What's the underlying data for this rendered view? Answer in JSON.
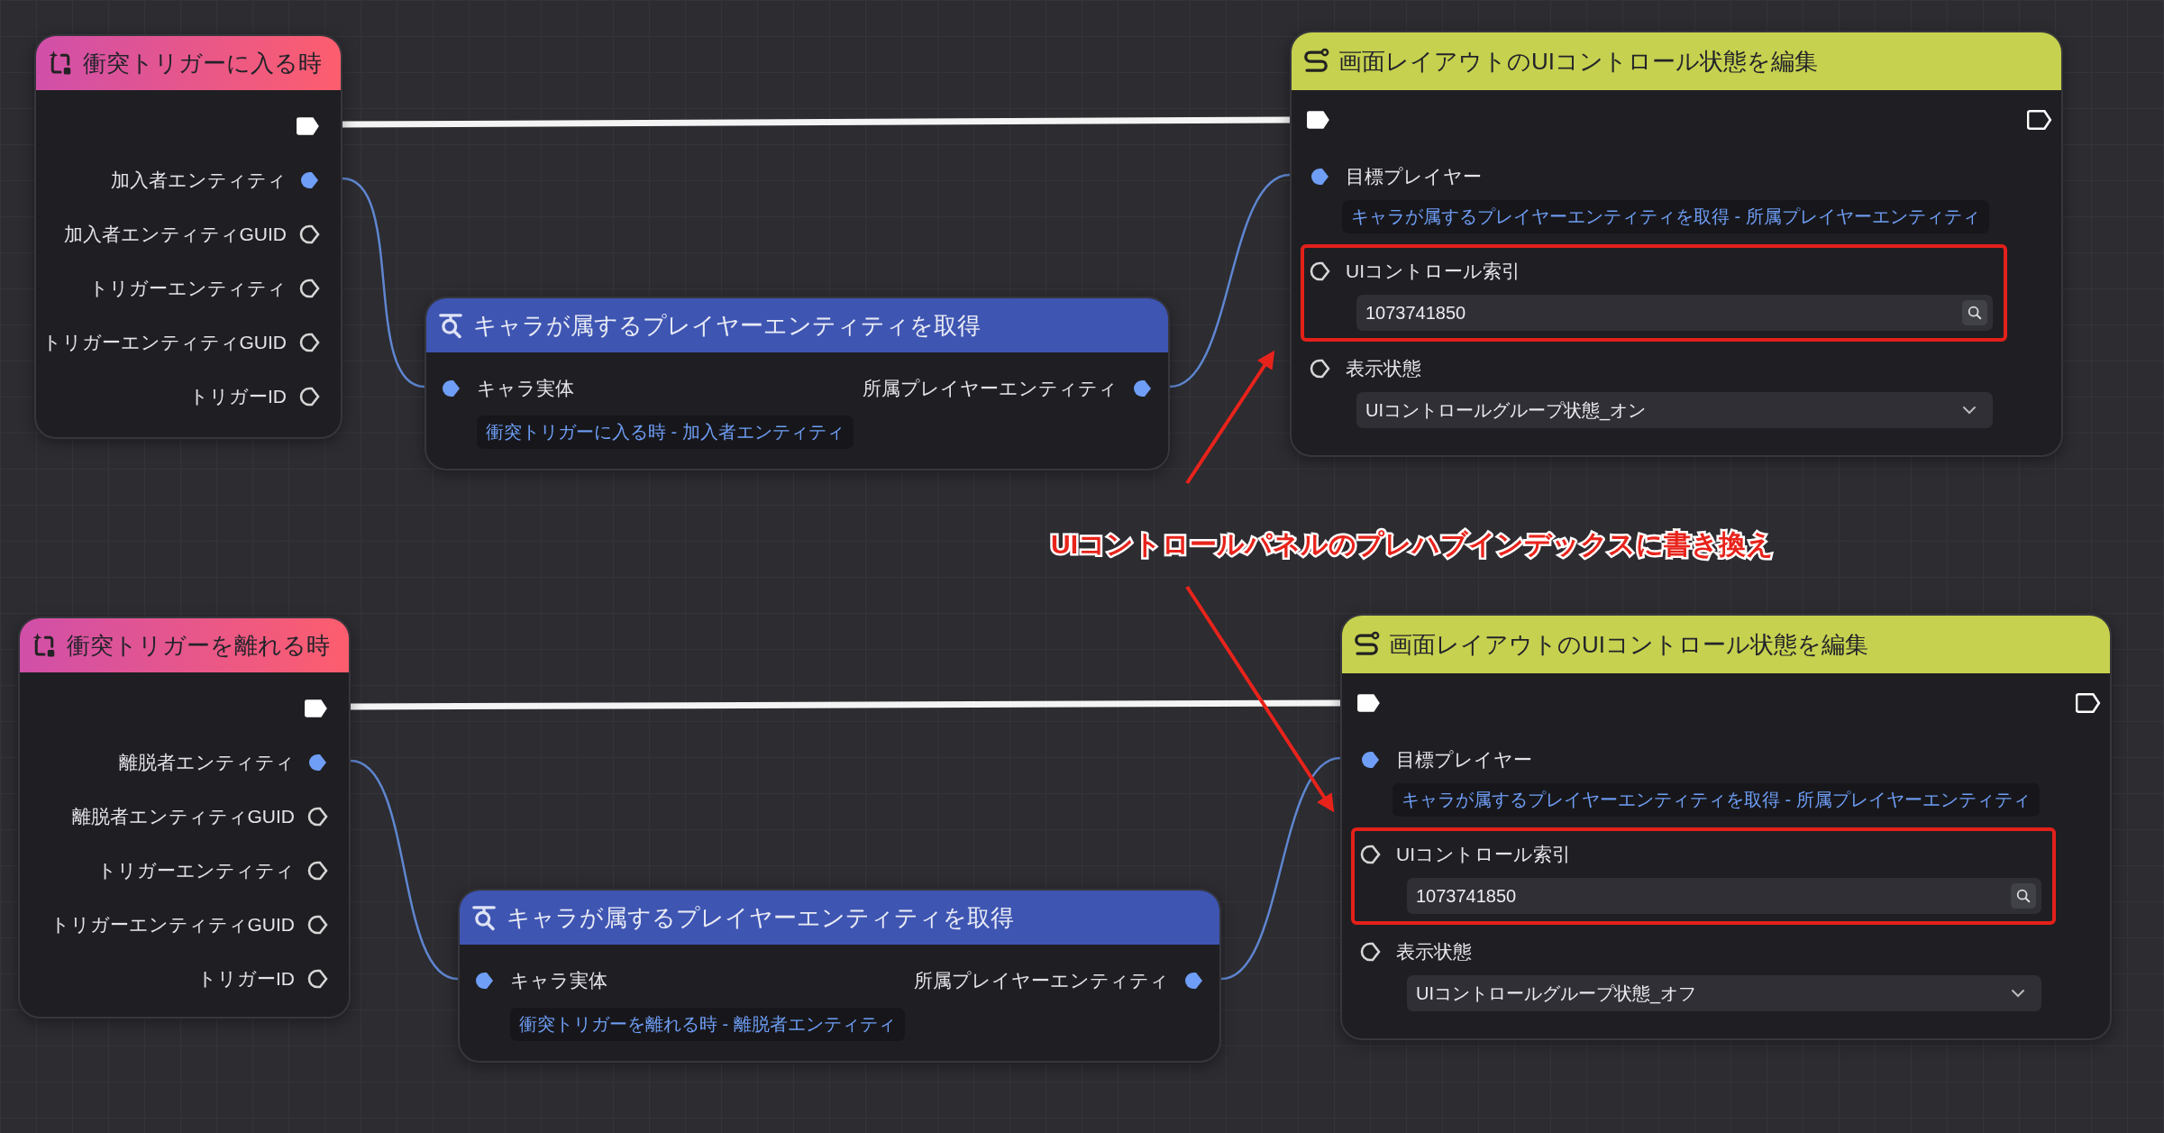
{
  "graphs": [
    {
      "event_node": {
        "title": "衝突トリガーに入る時",
        "exec_out": {
          "connected": true
        },
        "outputs": [
          {
            "label": "加入者エンティティ",
            "connected": true
          },
          {
            "label": "加入者エンティティGUID",
            "connected": false
          },
          {
            "label": "トリガーエンティティ",
            "connected": false
          },
          {
            "label": "トリガーエンティティGUID",
            "connected": false
          },
          {
            "label": "トリガーID",
            "connected": false
          }
        ]
      },
      "query_node": {
        "title": "キャラが属するプレイヤーエンティティを取得",
        "input": {
          "label": "キャラ実体",
          "connected": true,
          "source": "衝突トリガーに入る時 - 加入者エンティティ"
        },
        "output": {
          "label": "所属プレイヤーエンティティ",
          "connected": true
        }
      },
      "action_node": {
        "title": "画面レイアウトのUIコントロール状態を編集",
        "exec_in": {
          "connected": true
        },
        "exec_out": {
          "connected": false
        },
        "params": [
          {
            "kind": "link",
            "label": "目標プレイヤー",
            "connected": true,
            "highlighted": false,
            "value": "キャラが属するプレイヤーエンティティを取得 - 所属プレイヤーエンティティ"
          },
          {
            "kind": "search",
            "label": "UIコントロール索引",
            "connected": false,
            "highlighted": true,
            "value": "1073741850"
          },
          {
            "kind": "select",
            "label": "表示状態",
            "connected": false,
            "highlighted": false,
            "value": "UIコントロールグループ状態_オン"
          }
        ]
      }
    },
    {
      "event_node": {
        "title": "衝突トリガーを離れる時",
        "exec_out": {
          "connected": true
        },
        "outputs": [
          {
            "label": "離脱者エンティティ",
            "connected": true
          },
          {
            "label": "離脱者エンティティGUID",
            "connected": false
          },
          {
            "label": "トリガーエンティティ",
            "connected": false
          },
          {
            "label": "トリガーエンティティGUID",
            "connected": false
          },
          {
            "label": "トリガーID",
            "connected": false
          }
        ]
      },
      "query_node": {
        "title": "キャラが属するプレイヤーエンティティを取得",
        "input": {
          "label": "キャラ実体",
          "connected": true,
          "source": "衝突トリガーを離れる時 - 離脱者エンティティ"
        },
        "output": {
          "label": "所属プレイヤーエンティティ",
          "connected": true
        }
      },
      "action_node": {
        "title": "画面レイアウトのUIコントロール状態を編集",
        "exec_in": {
          "connected": true
        },
        "exec_out": {
          "connected": false
        },
        "params": [
          {
            "kind": "link",
            "label": "目標プレイヤー",
            "connected": true,
            "highlighted": false,
            "value": "キャラが属するプレイヤーエンティティを取得 - 所属プレイヤーエンティティ"
          },
          {
            "kind": "search",
            "label": "UIコントロール索引",
            "connected": false,
            "highlighted": true,
            "value": "1073741850"
          },
          {
            "kind": "select",
            "label": "表示状態",
            "connected": false,
            "highlighted": false,
            "value": "UIコントロールグループ状態_オフ"
          }
        ]
      }
    }
  ],
  "annotation": {
    "text": "UIコントロールパネルのプレハブインデックスに書き換え"
  }
}
